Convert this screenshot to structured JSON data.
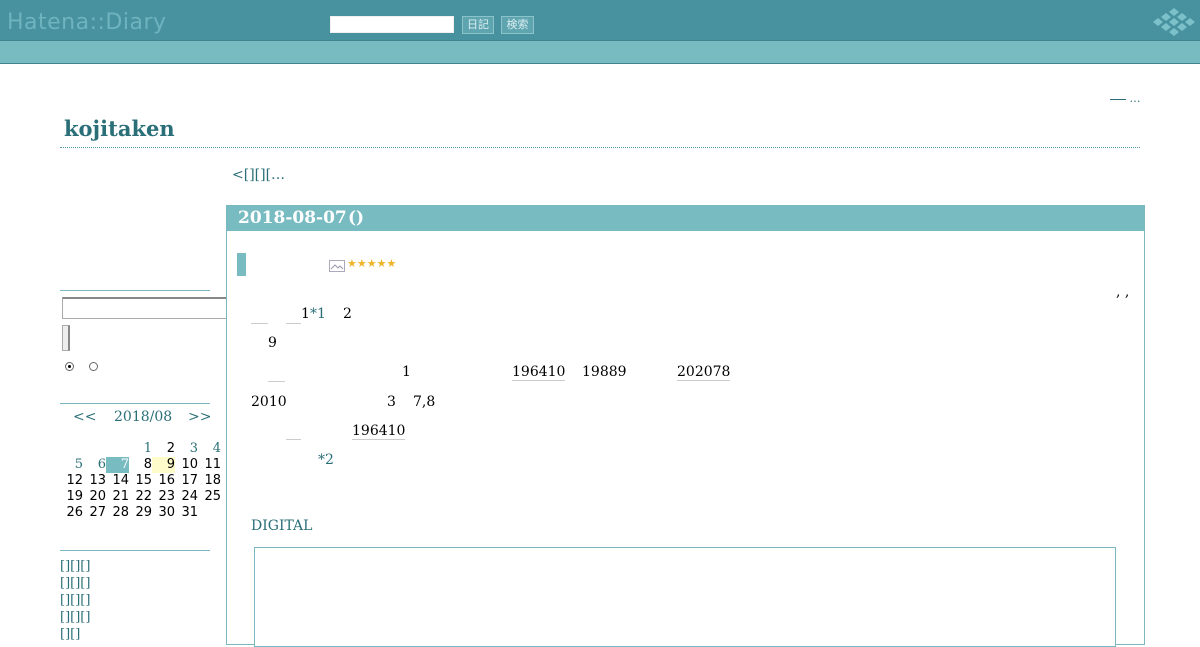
{
  "header": {
    "logo": "Hatena::Diary",
    "search_placeholder": "",
    "diary_button": "日記",
    "search_button": "検索"
  },
  "top_right_link": "…",
  "blog_title": "kojitaken",
  "nav_link": "<[][][…",
  "sidebar": {
    "search_value": "",
    "calendar": {
      "prev": "<<",
      "month": "2018/08",
      "next": ">>",
      "weeks": [
        [
          "",
          "",
          "",
          "1",
          "2",
          "3",
          "4"
        ],
        [
          "5",
          "6",
          "7",
          "8",
          "9",
          "10",
          "11"
        ],
        [
          "12",
          "13",
          "14",
          "15",
          "16",
          "17",
          "18"
        ],
        [
          "19",
          "20",
          "21",
          "22",
          "23",
          "24",
          "25"
        ],
        [
          "26",
          "27",
          "28",
          "29",
          "30",
          "31",
          ""
        ]
      ],
      "linked_days": [
        "1",
        "3",
        "4",
        "5",
        "6",
        "7"
      ],
      "today": "7",
      "highlight": "9"
    },
    "links": [
      "[][][]",
      "[][][]",
      "[][][]",
      "[][][]",
      "[][]"
    ]
  },
  "entry": {
    "date": "2018-08-07",
    "date_suffix": "()",
    "stars": "★★★★★",
    "commas": ", ,",
    "line1_num": "1",
    "footnote1": "*1",
    "line1_end": "2",
    "line2": "9",
    "line3_a": "1",
    "line3_b": "196410",
    "line3_c": "19889",
    "line3_d": "202078",
    "line4_a": "2010",
    "line4_b": "3",
    "line4_c": "7,8",
    "line5": "196410",
    "footnote2": "*2",
    "digital_link": "DIGITAL"
  },
  "colors": {
    "topbar": "#4892a0",
    "subbar": "#78bcc2",
    "accent": "#2a6f78",
    "star": "#f0b429"
  }
}
